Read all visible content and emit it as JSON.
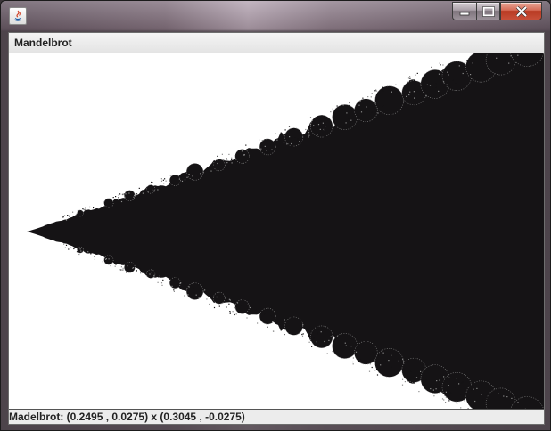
{
  "window": {
    "controls": {
      "minimize_icon": "minimize-icon",
      "maximize_icon": "maximize-icon",
      "close_icon": "close-icon"
    },
    "app_icon": "java-icon"
  },
  "panel": {
    "title": "Mandelbrot"
  },
  "fractal": {
    "region": {
      "re_min": 0.2495,
      "im_max": 0.0275,
      "re_max": 0.3045,
      "im_min": -0.0275
    },
    "fill_color": "#151315",
    "edge_color": "#8c8c8c",
    "background_color": "#ffffff"
  },
  "status": {
    "text": "Madelbrot: (0.2495 , 0.0275) x (0.3045 , -0.0275)"
  }
}
